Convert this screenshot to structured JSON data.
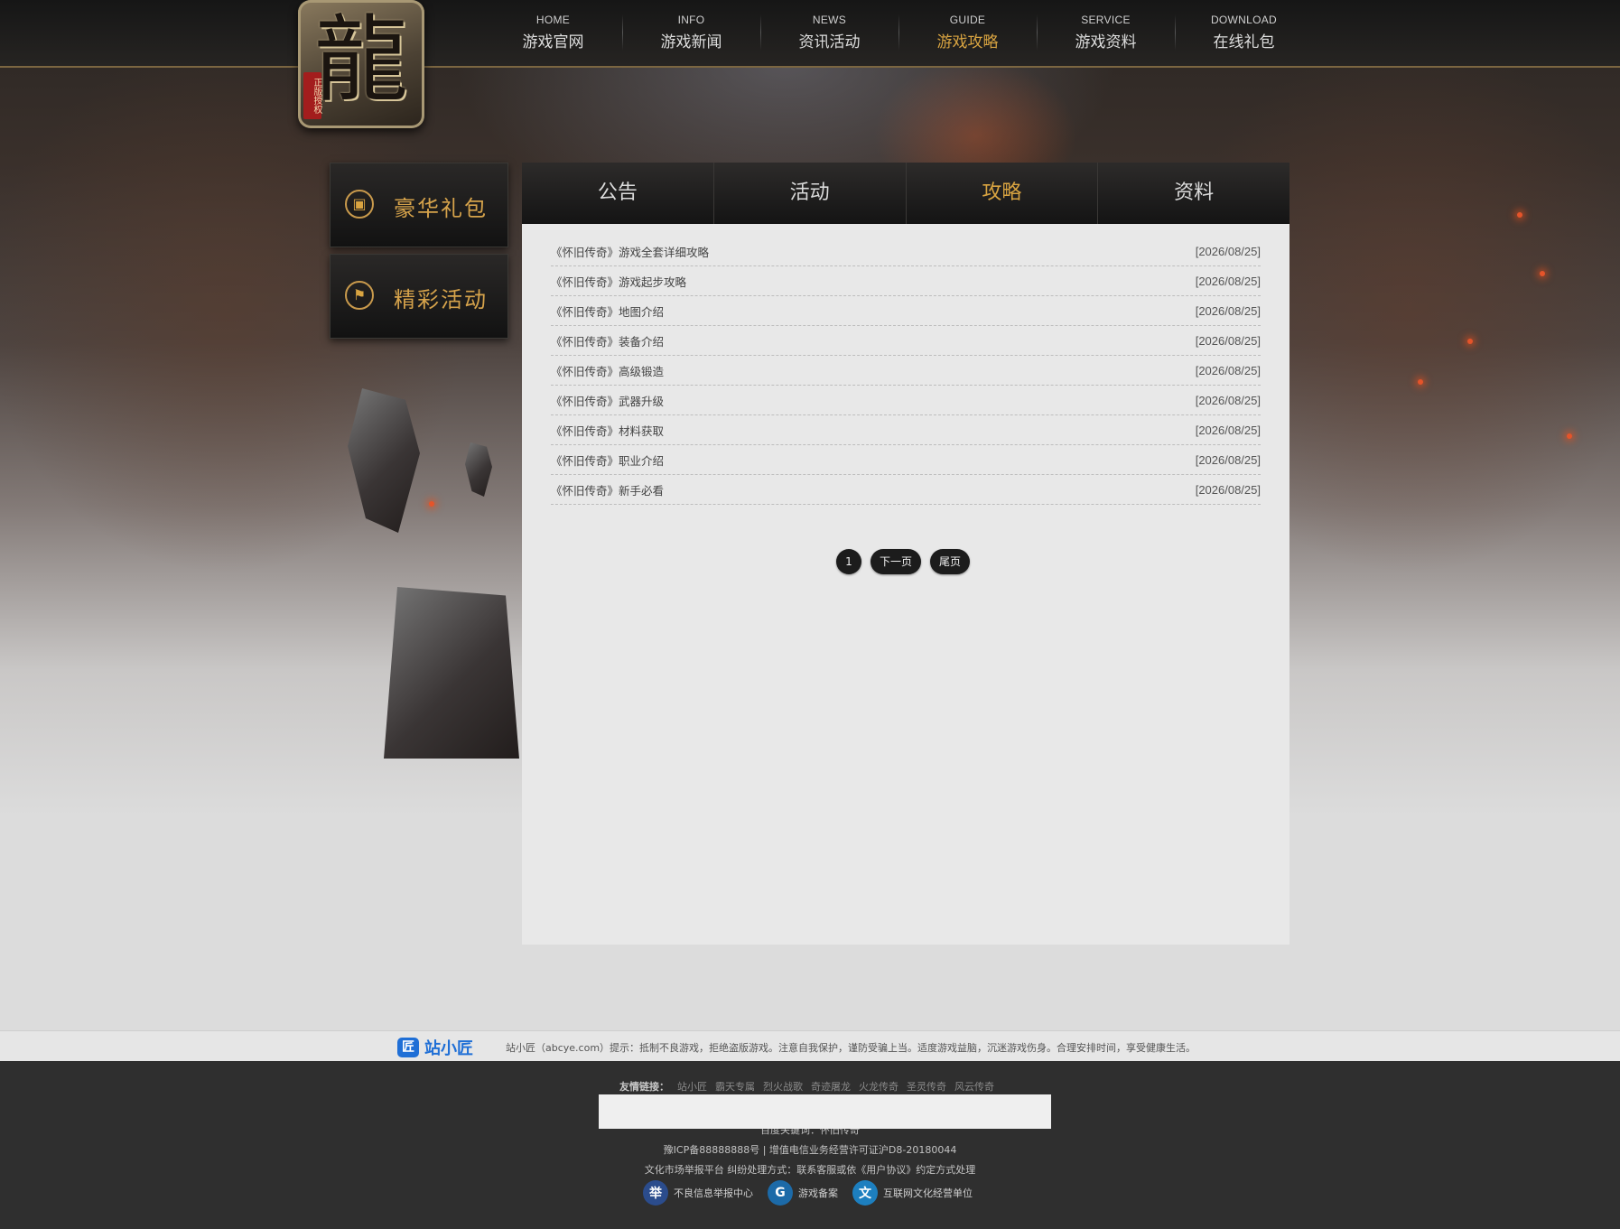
{
  "logo": {
    "glyph": "龍",
    "seal": "正版授权"
  },
  "nav": [
    {
      "en": "HOME",
      "cn": "游戏官网"
    },
    {
      "en": "INFO",
      "cn": "游戏新闻"
    },
    {
      "en": "NEWS",
      "cn": "资讯活动"
    },
    {
      "en": "GUIDE",
      "cn": "游戏攻略",
      "active": true
    },
    {
      "en": "SERVICE",
      "cn": "游戏资料"
    },
    {
      "en": "DOWNLOAD",
      "cn": "在线礼包"
    }
  ],
  "side": [
    {
      "label": "豪华礼包",
      "icon": "gift-icon"
    },
    {
      "label": "精彩活动",
      "icon": "flag-icon"
    }
  ],
  "tabs": [
    "公告",
    "活动",
    "攻略",
    "资料"
  ],
  "active_tab": "攻略",
  "articles": [
    {
      "title": "《怀旧传奇》游戏全套详细攻略",
      "date": "[2026/08/25]"
    },
    {
      "title": "《怀旧传奇》游戏起步攻略",
      "date": "[2026/08/25]"
    },
    {
      "title": "《怀旧传奇》地图介绍",
      "date": "[2026/08/25]"
    },
    {
      "title": "《怀旧传奇》装备介绍",
      "date": "[2026/08/25]"
    },
    {
      "title": "《怀旧传奇》高级锻造",
      "date": "[2026/08/25]"
    },
    {
      "title": "《怀旧传奇》武器升级",
      "date": "[2026/08/25]"
    },
    {
      "title": "《怀旧传奇》材料获取",
      "date": "[2026/08/25]"
    },
    {
      "title": "《怀旧传奇》职业介绍",
      "date": "[2026/08/25]"
    },
    {
      "title": "《怀旧传奇》新手必看",
      "date": "[2026/08/25]"
    }
  ],
  "pager": {
    "current": "1",
    "next": "下一页",
    "last": "尾页"
  },
  "notice": {
    "brand_icon": "匠",
    "brand": "站小匠",
    "text": "站小匠（abcye.com）提示：抵制不良游戏，拒绝盗版游戏。注意自我保护，谨防受骗上当。适度游戏益脑，沉迷游戏伤身。合理安排时间，享受健康生活。"
  },
  "footer": {
    "links_label": "友情链接：",
    "links": [
      "站小匠",
      "霸天专属",
      "烈火战歌",
      "奇迹屠龙",
      "火龙传奇",
      "圣灵传奇",
      "风云传奇"
    ],
    "keywords": "百度关键词：怀旧传奇",
    "icp": "豫ICP备88888888号 | 增值电信业务经营许可证沪D8-20180044",
    "dispute": "文化市场举报平台 纠纷处理方式：联系客服或依《用户协议》约定方式处理",
    "badges": [
      {
        "label": "不良信息举报中心",
        "icon": "report-center-icon",
        "glyph": "举",
        "color": "#2b4c8c"
      },
      {
        "label": "游戏备案",
        "icon": "game-record-icon",
        "glyph": "G",
        "color": "#1c6aa8"
      },
      {
        "label": "互联网文化经营单位",
        "icon": "culture-unit-icon",
        "glyph": "文",
        "color": "#1d7fbf"
      }
    ]
  }
}
